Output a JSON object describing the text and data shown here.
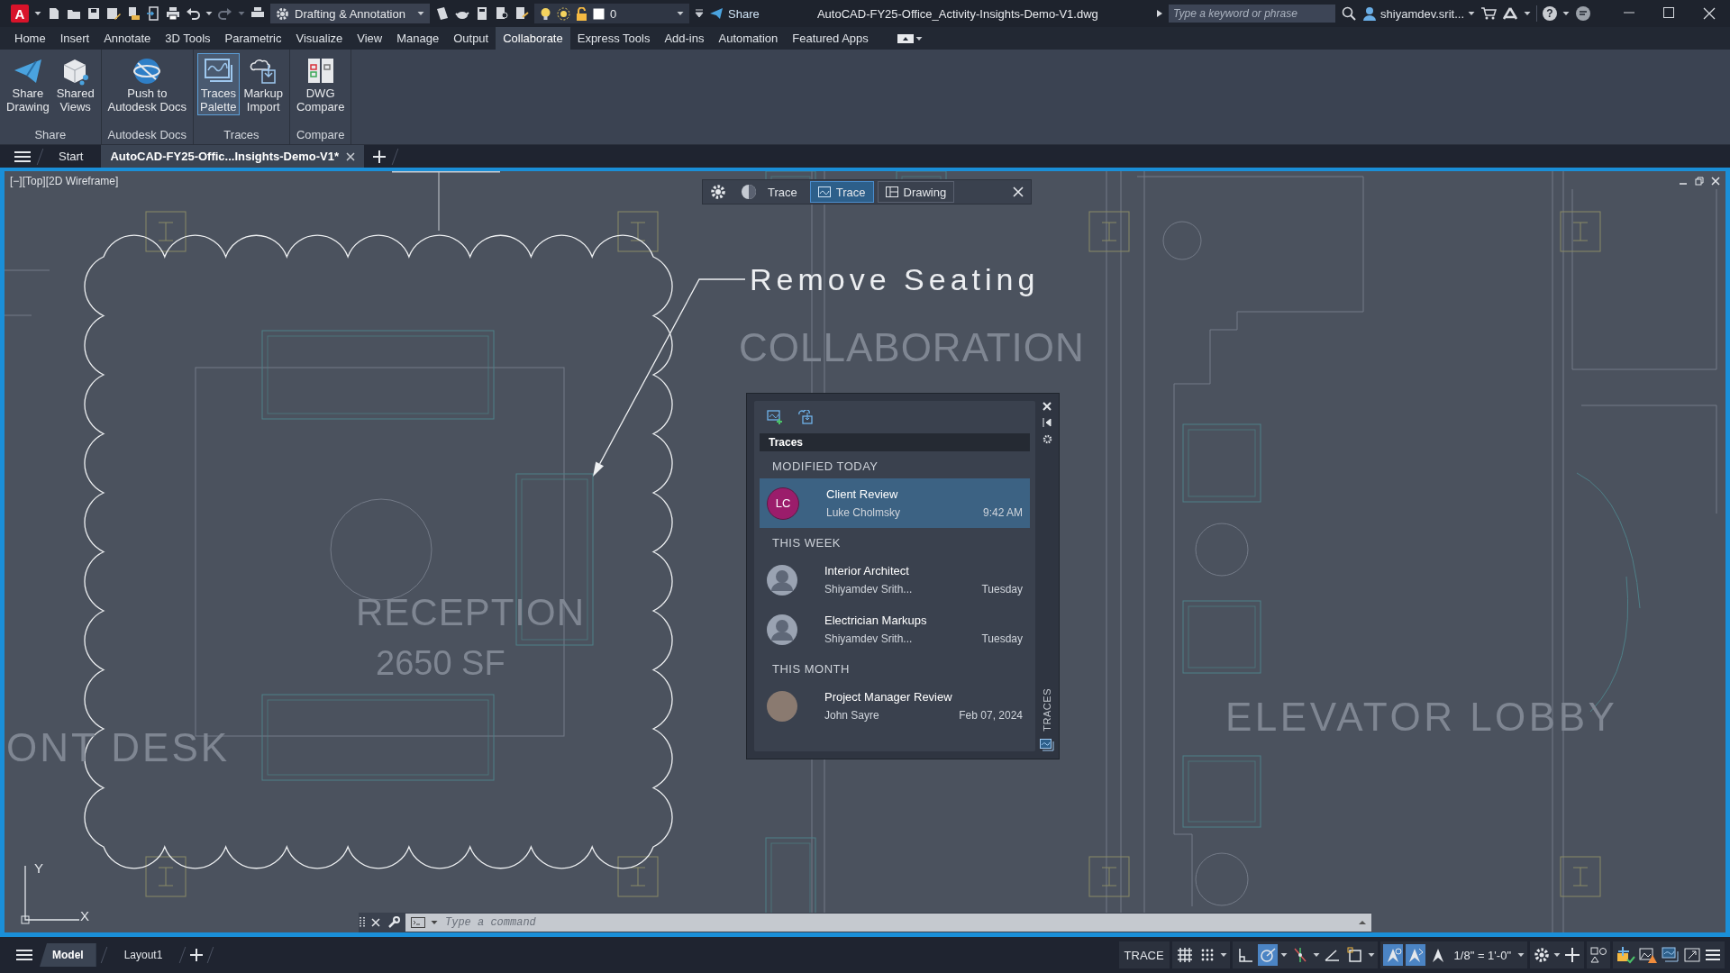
{
  "title_bar": {
    "app_logo": "A",
    "workspace": "Drafting & Annotation",
    "layer": "0",
    "share": "Share",
    "document_title": "AutoCAD-FY25-Office_Activity-Insights-Demo-V1.dwg",
    "search": {
      "placeholder": "Type a keyword or phrase"
    },
    "user": "shiyamdev.srit...",
    "help": "?"
  },
  "ribbon_tabs": [
    {
      "label": "Home",
      "selected": false
    },
    {
      "label": "Insert",
      "selected": false
    },
    {
      "label": "Annotate",
      "selected": false
    },
    {
      "label": "3D Tools",
      "selected": false
    },
    {
      "label": "Parametric",
      "selected": false
    },
    {
      "label": "Visualize",
      "selected": false
    },
    {
      "label": "View",
      "selected": false
    },
    {
      "label": "Manage",
      "selected": false
    },
    {
      "label": "Output",
      "selected": false
    },
    {
      "label": "Collaborate",
      "selected": true
    },
    {
      "label": "Express Tools",
      "selected": false
    },
    {
      "label": "Add-ins",
      "selected": false
    },
    {
      "label": "Automation",
      "selected": false
    },
    {
      "label": "Featured Apps",
      "selected": false
    }
  ],
  "ribbon_panels": [
    {
      "title": "Share",
      "buttons": [
        {
          "kind": "share",
          "label": "Share\nDrawing",
          "selected": false
        },
        {
          "kind": "views",
          "label": "Shared\nViews",
          "selected": false
        }
      ]
    },
    {
      "title": "Autodesk Docs",
      "buttons": [
        {
          "kind": "docs",
          "label": "Push to\nAutodesk Docs",
          "selected": false
        }
      ]
    },
    {
      "title": "Traces",
      "buttons": [
        {
          "kind": "traces",
          "label": "Traces\nPalette",
          "selected": true
        },
        {
          "kind": "markup",
          "label": "Markup\nImport",
          "selected": false
        }
      ]
    },
    {
      "title": "Compare",
      "buttons": [
        {
          "kind": "compare",
          "label": "DWG\nCompare",
          "selected": false
        }
      ]
    }
  ],
  "file_tabs": [
    {
      "label": "Start",
      "selected": false
    },
    {
      "label": "AutoCAD-FY25-Offic...Insights-Demo-V1*",
      "selected": true
    }
  ],
  "viewport": {
    "label": "[−][Top][2D Wireframe]",
    "axis_labels": [
      "Y",
      "X"
    ],
    "annotations": [
      {
        "kind": "markup",
        "text": "Remove Seating"
      },
      {
        "kind": "room",
        "text": "COLLABORATION"
      },
      {
        "kind": "room",
        "text": "RECEPTION"
      },
      {
        "kind": "room",
        "text": "2650 SF"
      },
      {
        "kind": "room",
        "text": "ONT DESK"
      },
      {
        "kind": "room",
        "text": "ELEVATOR LOBBY"
      }
    ]
  },
  "trace_toolbar": {
    "trace_toggle": "Trace",
    "tabs": [
      {
        "label": "Trace",
        "selected": true
      },
      {
        "label": "Drawing",
        "selected": false
      }
    ]
  },
  "traces_palette": {
    "title": "Traces",
    "side_label": "TRACES",
    "groups": [
      {
        "heading": "MODIFIED TODAY",
        "items": [
          {
            "name": "Client Review",
            "author": "Luke Cholmsky",
            "time": "9:42 AM",
            "avatar": {
              "kind": "initials",
              "initials": "LC"
            },
            "selected": true
          }
        ]
      },
      {
        "heading": "THIS WEEK",
        "items": [
          {
            "name": "Interior Architect",
            "author": "Shiyamdev Srith...",
            "time": "Tuesday",
            "avatar": {
              "kind": "generic"
            },
            "selected": false
          },
          {
            "name": "Electrician Markups",
            "author": "Shiyamdev Srith...",
            "time": "Tuesday",
            "avatar": {
              "kind": "generic"
            },
            "selected": false
          }
        ]
      },
      {
        "heading": "THIS MONTH",
        "items": [
          {
            "name": "Project Manager Review",
            "author": "John Sayre",
            "time": "Feb 07, 2024",
            "avatar": {
              "kind": "photo"
            },
            "selected": false
          }
        ]
      }
    ]
  },
  "command_line": {
    "placeholder": "Type a command"
  },
  "status_bar": {
    "layout_tabs": [
      {
        "label": "Model",
        "selected": true
      },
      {
        "label": "Layout1",
        "selected": false
      }
    ],
    "trace_button": "TRACE",
    "toggles": [
      {
        "kind": "grid",
        "on": false
      },
      {
        "kind": "snap",
        "on": false
      },
      {
        "kind": "ortho",
        "on": false
      },
      {
        "kind": "polar",
        "on": true
      },
      {
        "kind": "tracking",
        "on": false
      },
      {
        "kind": "angle",
        "on": false
      },
      {
        "kind": "ucs",
        "on": false
      },
      {
        "kind": "annovis",
        "on": true
      },
      {
        "kind": "autoscale",
        "on": true
      },
      {
        "kind": "annoscale",
        "on": false
      }
    ],
    "scale": "1/8\" = 1'-0\""
  }
}
